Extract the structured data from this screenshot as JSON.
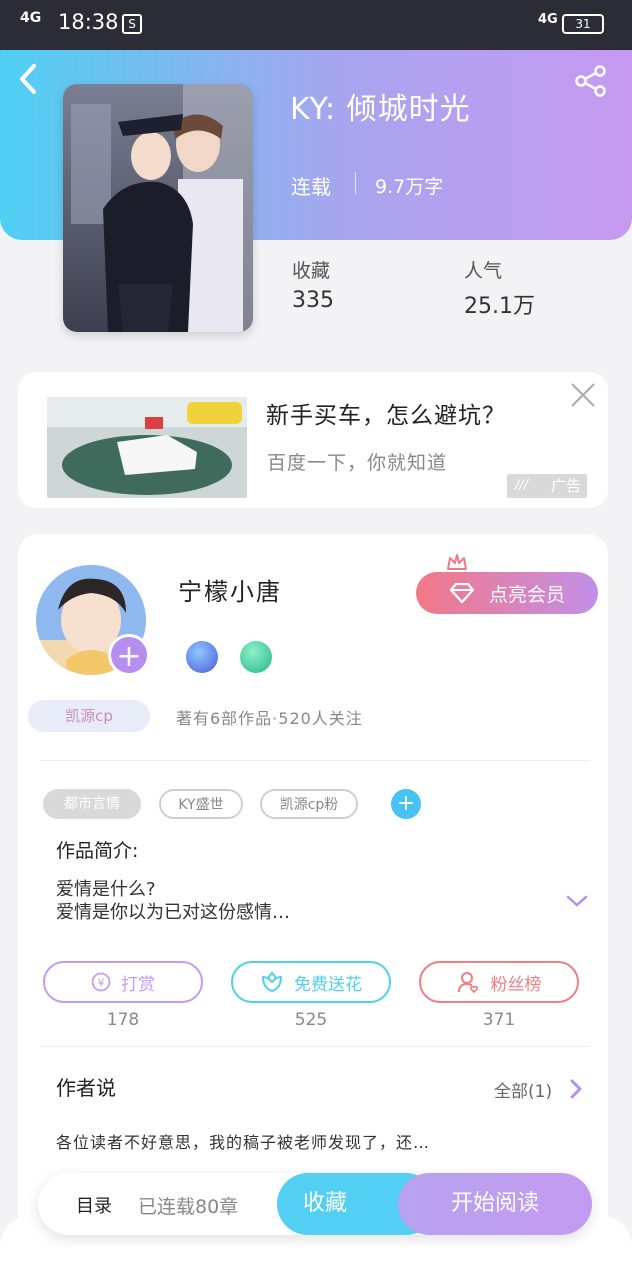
{
  "status_bar": {
    "signal": "4G",
    "time": "18:38",
    "s_icon": "S",
    "net": "4G",
    "battery": "31"
  },
  "book": {
    "title": "KY: 倾城时光",
    "status": "连载",
    "words": "9.7万字",
    "stats": [
      {
        "label": "收藏",
        "value": "335"
      },
      {
        "label": "人气",
        "value": "25.1万"
      }
    ]
  },
  "ad": {
    "title": "新手买车，怎么避坑？",
    "subtitle": "百度一下，你就知道",
    "tag": "广告"
  },
  "author": {
    "name": "宁檬小唐",
    "vip_label": "点亮会员",
    "tag": "凯源cp",
    "meta": "著有6部作品·520人关注"
  },
  "tags": [
    "都市言情",
    "KY盛世",
    "凯源cp粉"
  ],
  "intro": {
    "heading": "作品简介:",
    "lines": [
      "爱情是什么?",
      "爱情是你以为已对这份感情…"
    ]
  },
  "actions": [
    {
      "label": "打赏",
      "count": "178",
      "icon": "yuan-coin-icon",
      "color": "#c39cf0"
    },
    {
      "label": "免费送花",
      "count": "525",
      "icon": "flower-icon",
      "color": "#4fd0ec"
    },
    {
      "label": "粉丝榜",
      "count": "371",
      "icon": "fan-user-icon",
      "color": "#f07e86"
    }
  ],
  "author_says": {
    "heading": "作者说",
    "all": "全部(1)",
    "text": "各位读者不好意思，我的稿子被老师发现了，还…"
  },
  "bottom": {
    "toc": "目录",
    "chapters": "已连载80章",
    "favorite": "收藏",
    "read": "开始阅读"
  },
  "colors": {
    "gradient_start": "#4fd0f2",
    "gradient_end": "#c69af0",
    "accent_blue": "#52cff3",
    "accent_purple": "#c39bf1",
    "vip_pink": "#f27887"
  }
}
